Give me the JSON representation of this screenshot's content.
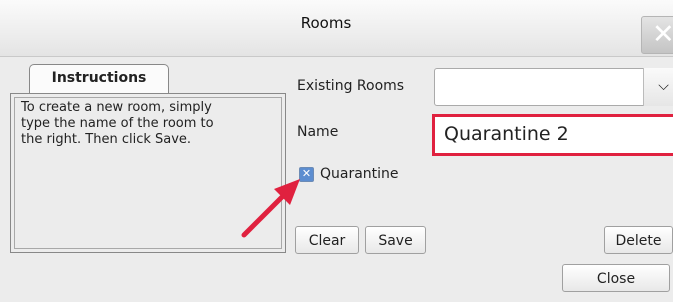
{
  "window": {
    "title": "Rooms",
    "close_glyph": "✕"
  },
  "instructions": {
    "tab_label": "Instructions",
    "text_lines": [
      "To create a new room, simply",
      "type the name of the room to",
      "the right. Then click Save."
    ]
  },
  "form": {
    "existing_rooms_label": "Existing Rooms",
    "existing_rooms_value": "",
    "name_label": "Name",
    "name_value": "Quarantine 2",
    "quarantine_label": "Quarantine",
    "quarantine_checked": true
  },
  "buttons": {
    "clear": "Clear",
    "save": "Save",
    "delete": "Delete",
    "close": "Close"
  },
  "annotation": {
    "highlight_color": "#e0213f",
    "arrow_color": "#e0213f"
  }
}
